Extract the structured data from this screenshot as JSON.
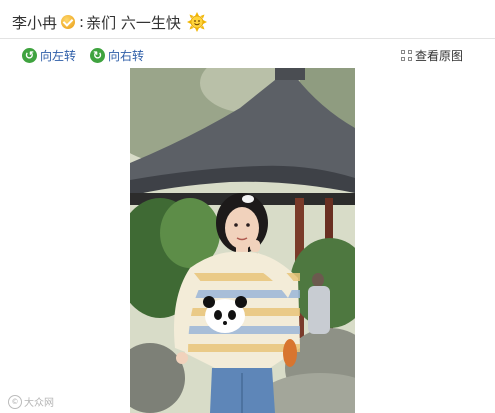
{
  "post": {
    "username": "李小冉",
    "message": "亲们 六一生快",
    "verified_icon": "verified-badge-icon",
    "emoji_icon": "sun-smiley-icon"
  },
  "toolbar": {
    "rotate_left_label": "向左转",
    "rotate_right_label": "向右转",
    "view_original_label": "查看原图",
    "link_color": "#2e5ea8",
    "icon_color": "#3fa33f"
  },
  "photo": {
    "description_icon": "childhood-photo"
  },
  "watermark": {
    "text": "大众网"
  }
}
